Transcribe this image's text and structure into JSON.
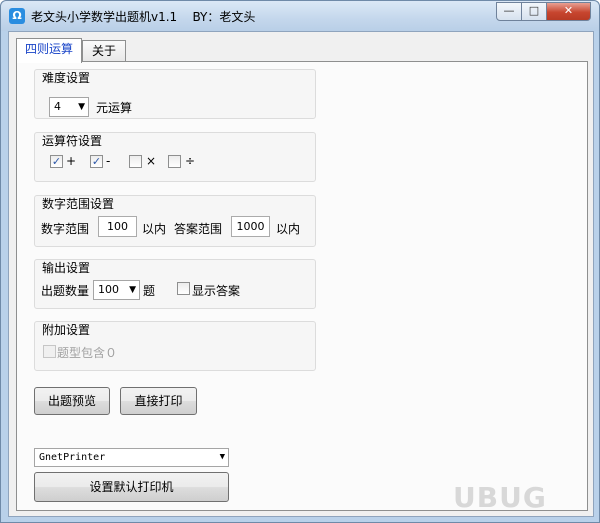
{
  "window": {
    "title": "老文头小学数学出题机v1.1    BY：老文头",
    "app_icon": "Ω",
    "minimize": "—",
    "maximize": "□",
    "close": "✕"
  },
  "tabs": [
    {
      "label": "四则运算",
      "active": true
    },
    {
      "label": "关于",
      "active": false
    }
  ],
  "difficulty": {
    "title": "难度设置",
    "operand_count": "4",
    "suffix": "元运算"
  },
  "operators": {
    "title": "运算符设置",
    "items": [
      {
        "label": "+",
        "checked": true
      },
      {
        "label": "-",
        "checked": true
      },
      {
        "label": "×",
        "checked": false
      },
      {
        "label": "÷",
        "checked": false
      }
    ]
  },
  "range": {
    "title": "数字范围设置",
    "number_label": "数字范围",
    "number_value": "100",
    "within1": "以内",
    "answer_label": "答案范围",
    "answer_value": "1000",
    "within2": "以内"
  },
  "output": {
    "title": "输出设置",
    "count_label": "出题数量",
    "count_value": "100",
    "count_suffix": "题",
    "show_answer_label": "显示答案",
    "show_answer_checked": false
  },
  "extra": {
    "title": "附加设置",
    "include_zero_label": "题型包含０",
    "include_zero_checked": false
  },
  "actions": {
    "preview": "出题预览",
    "print": "直接打印"
  },
  "printer": {
    "selected": "GnetPrinter",
    "set_default": "设置默认打印机"
  },
  "watermark": "UBUG"
}
